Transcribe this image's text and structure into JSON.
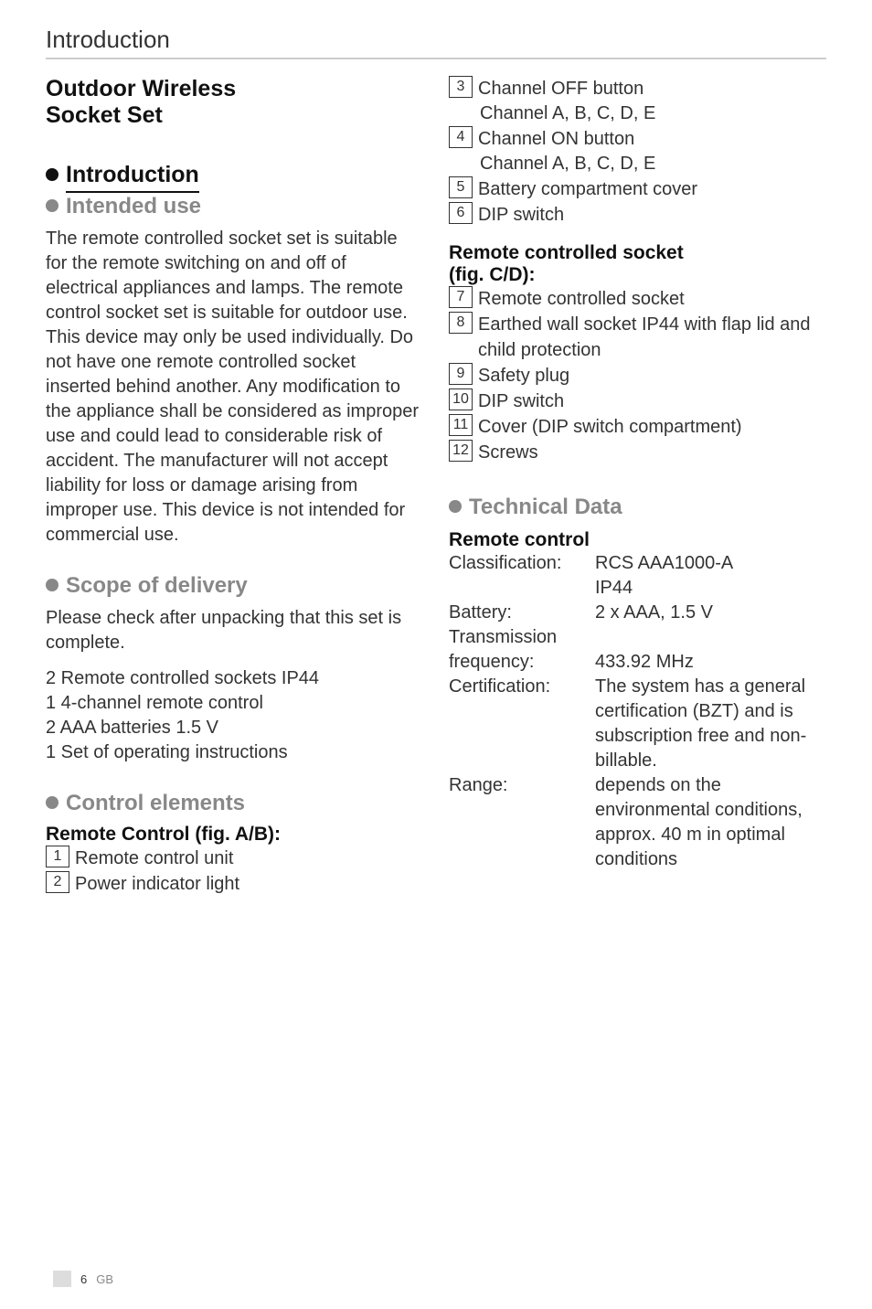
{
  "header": {
    "label": "Introduction"
  },
  "title": {
    "line1": "Outdoor Wireless",
    "line2": "Socket Set"
  },
  "sections": {
    "introduction": "Introduction",
    "intended_use": "Intended use",
    "scope": "Scope of delivery",
    "control_elements": "Control elements",
    "technical_data": "Technical Data"
  },
  "intended_use_body": "The remote controlled socket set is suitable for the remote switching on and off of electrical appliances and lamps. The remote control socket set is suitable for outdoor use. This device may only be used individually. Do not have one remote controlled socket inserted behind another. Any modification to the appliance shall be considered as improper use and could lead to considerable risk of accident. The manufacturer will not accept liability for loss or damage arising from improper use. This device is not intended for commercial use.",
  "scope_body": "Please check after unpacking that this set is complete.",
  "scope_list": [
    "2 Remote controlled sockets IP44",
    "1 4-channel remote control",
    "2 AAA batteries 1.5 V",
    "1 Set of operating instructions"
  ],
  "remote_heading": "Remote Control (fig. A/B):",
  "remote_items": [
    {
      "n": "1",
      "t": "Remote control unit"
    },
    {
      "n": "2",
      "t": "Power indicator light"
    },
    {
      "n": "3",
      "t": "Channel OFF button",
      "sub": "Channel A, B, C, D, E"
    },
    {
      "n": "4",
      "t": "Channel ON button",
      "sub": "Channel A, B, C, D, E"
    },
    {
      "n": "5",
      "t": "Battery compartment cover"
    },
    {
      "n": "6",
      "t": "DIP switch"
    }
  ],
  "socket_heading1": "Remote controlled socket",
  "socket_heading2": "(fig. C/D):",
  "socket_items": [
    {
      "n": "7",
      "t": "Remote controlled socket"
    },
    {
      "n": "8",
      "t": "Earthed wall socket IP44 with flap lid and child protection"
    },
    {
      "n": "9",
      "t": "Safety plug"
    },
    {
      "n": "10",
      "t": "DIP switch"
    },
    {
      "n": "11",
      "t": "Cover (DIP switch compartment)"
    },
    {
      "n": "12",
      "t": "Screws"
    }
  ],
  "tech_subheading": "Remote control",
  "tech": {
    "classification_label": "Classification:",
    "classification_val1": "RCS AAA1000-A",
    "classification_val2": "IP44",
    "battery_label": "Battery:",
    "battery_val": "2 x AAA, 1.5 V",
    "transmission_label": "Transmission",
    "frequency_label": "frequency:",
    "frequency_val": "433.92 MHz",
    "certification_label": "Certification:",
    "certification_val": "The system has a general certification (BZT) and is subscription free and non-billable.",
    "range_label": "Range:",
    "range_val": "depends on the environmental conditions, approx. 40 m in optimal conditions"
  },
  "footer": {
    "page": "6",
    "gb": "GB"
  }
}
